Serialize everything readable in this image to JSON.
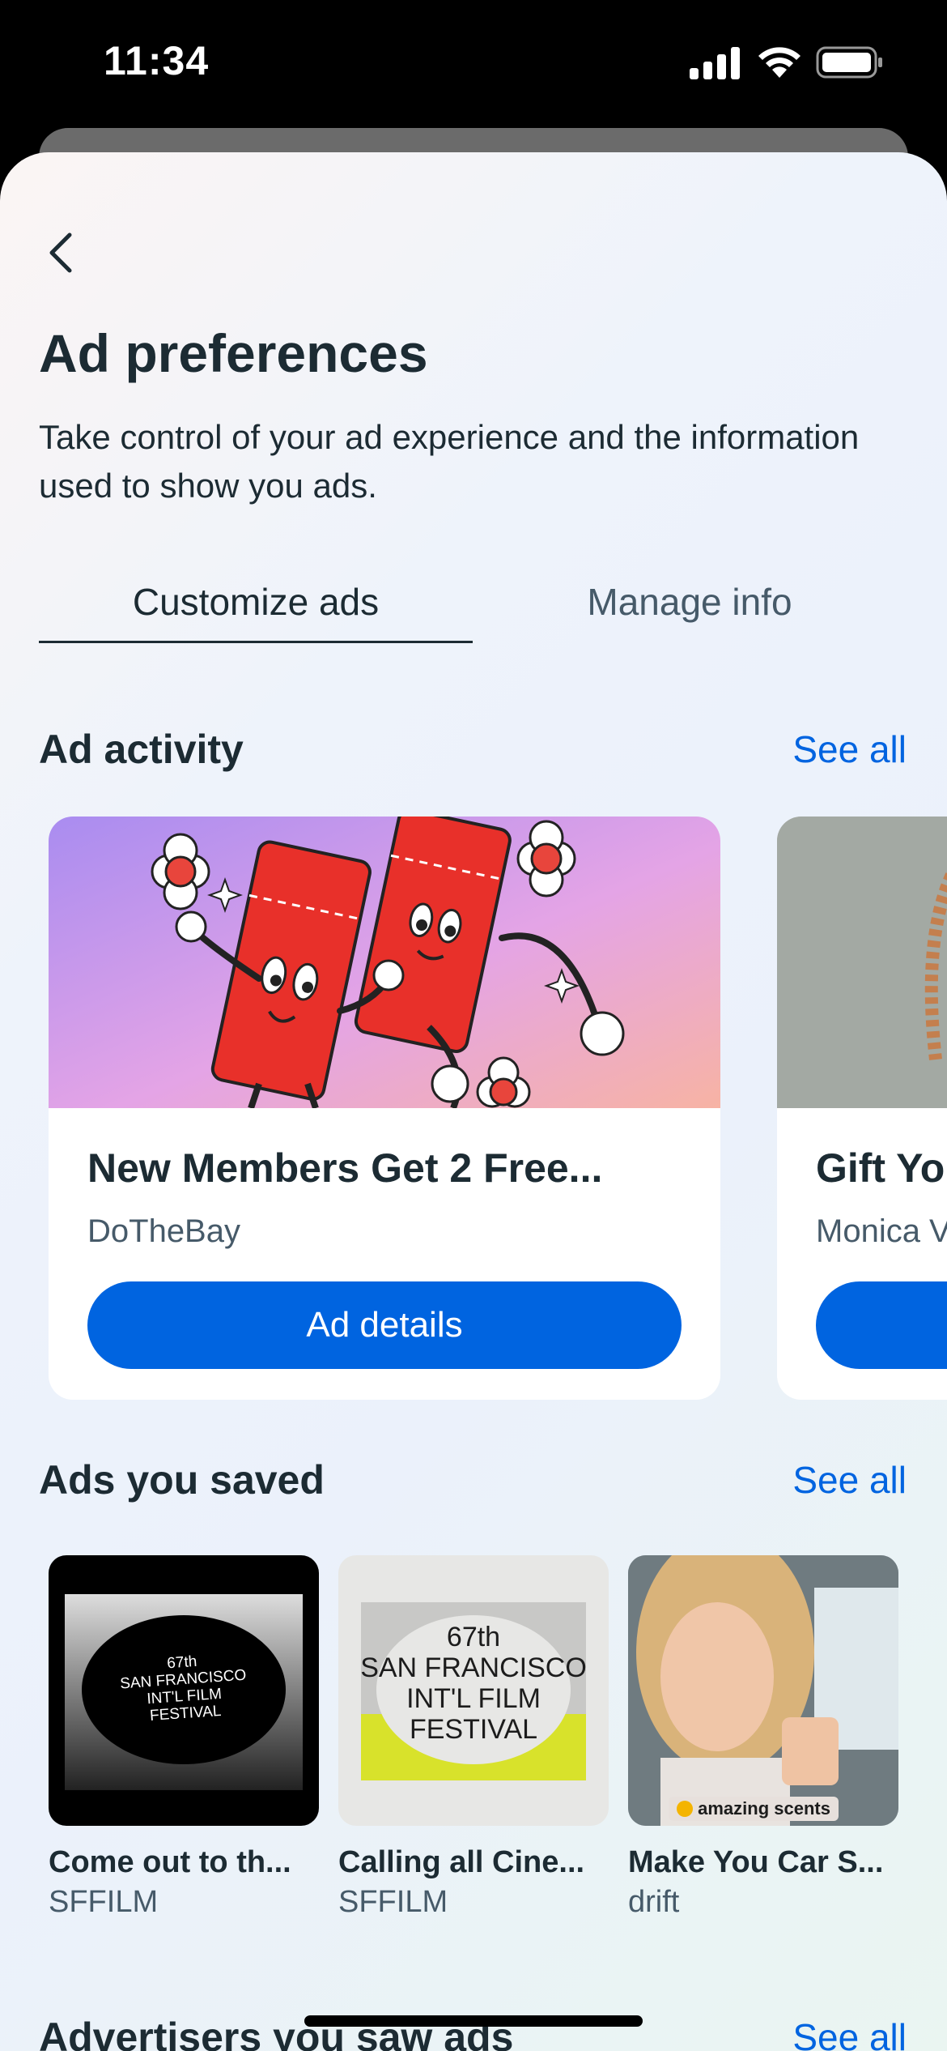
{
  "status_bar": {
    "time": "11:34"
  },
  "header": {
    "title": "Ad preferences",
    "subtitle": "Take control of your ad experience and the information used to show you ads."
  },
  "tabs": [
    {
      "label": "Customize ads",
      "selected": true
    },
    {
      "label": "Manage info",
      "selected": false
    }
  ],
  "ad_activity": {
    "title": "Ad activity",
    "see_all": "See all",
    "cards": [
      {
        "title": "New Members Get 2 Free...",
        "advertiser": "DoTheBay",
        "button": "Ad details"
      },
      {
        "title": "Gift Yo",
        "advertiser": "Monica V",
        "button": ""
      }
    ]
  },
  "ads_saved": {
    "title": "Ads you saved",
    "see_all": "See all",
    "items": [
      {
        "title": "Come out to th...",
        "advertiser": "SFFILM",
        "poster": {
          "line1": "67th",
          "line2": "SAN FRANCISCO",
          "line3": "INT'L",
          "line3b": "FILM",
          "line4": "FESTIVAL"
        }
      },
      {
        "title": "Calling all Cine...",
        "advertiser": "SFFILM",
        "poster": {
          "line1": "67th",
          "line2": "SAN FRANCISCO",
          "line3": "INT'L",
          "line3b": "FILM",
          "line4": "FESTIVAL"
        }
      },
      {
        "title": "Make You Car S...",
        "advertiser": "drift",
        "overlay": "amazing scents"
      }
    ]
  },
  "advertisers": {
    "title": "Advertisers you saw ads",
    "see_all": "See all"
  },
  "colors": {
    "accent": "#0064e0",
    "text_primary": "#1c2b33",
    "text_secondary": "#465a69"
  }
}
